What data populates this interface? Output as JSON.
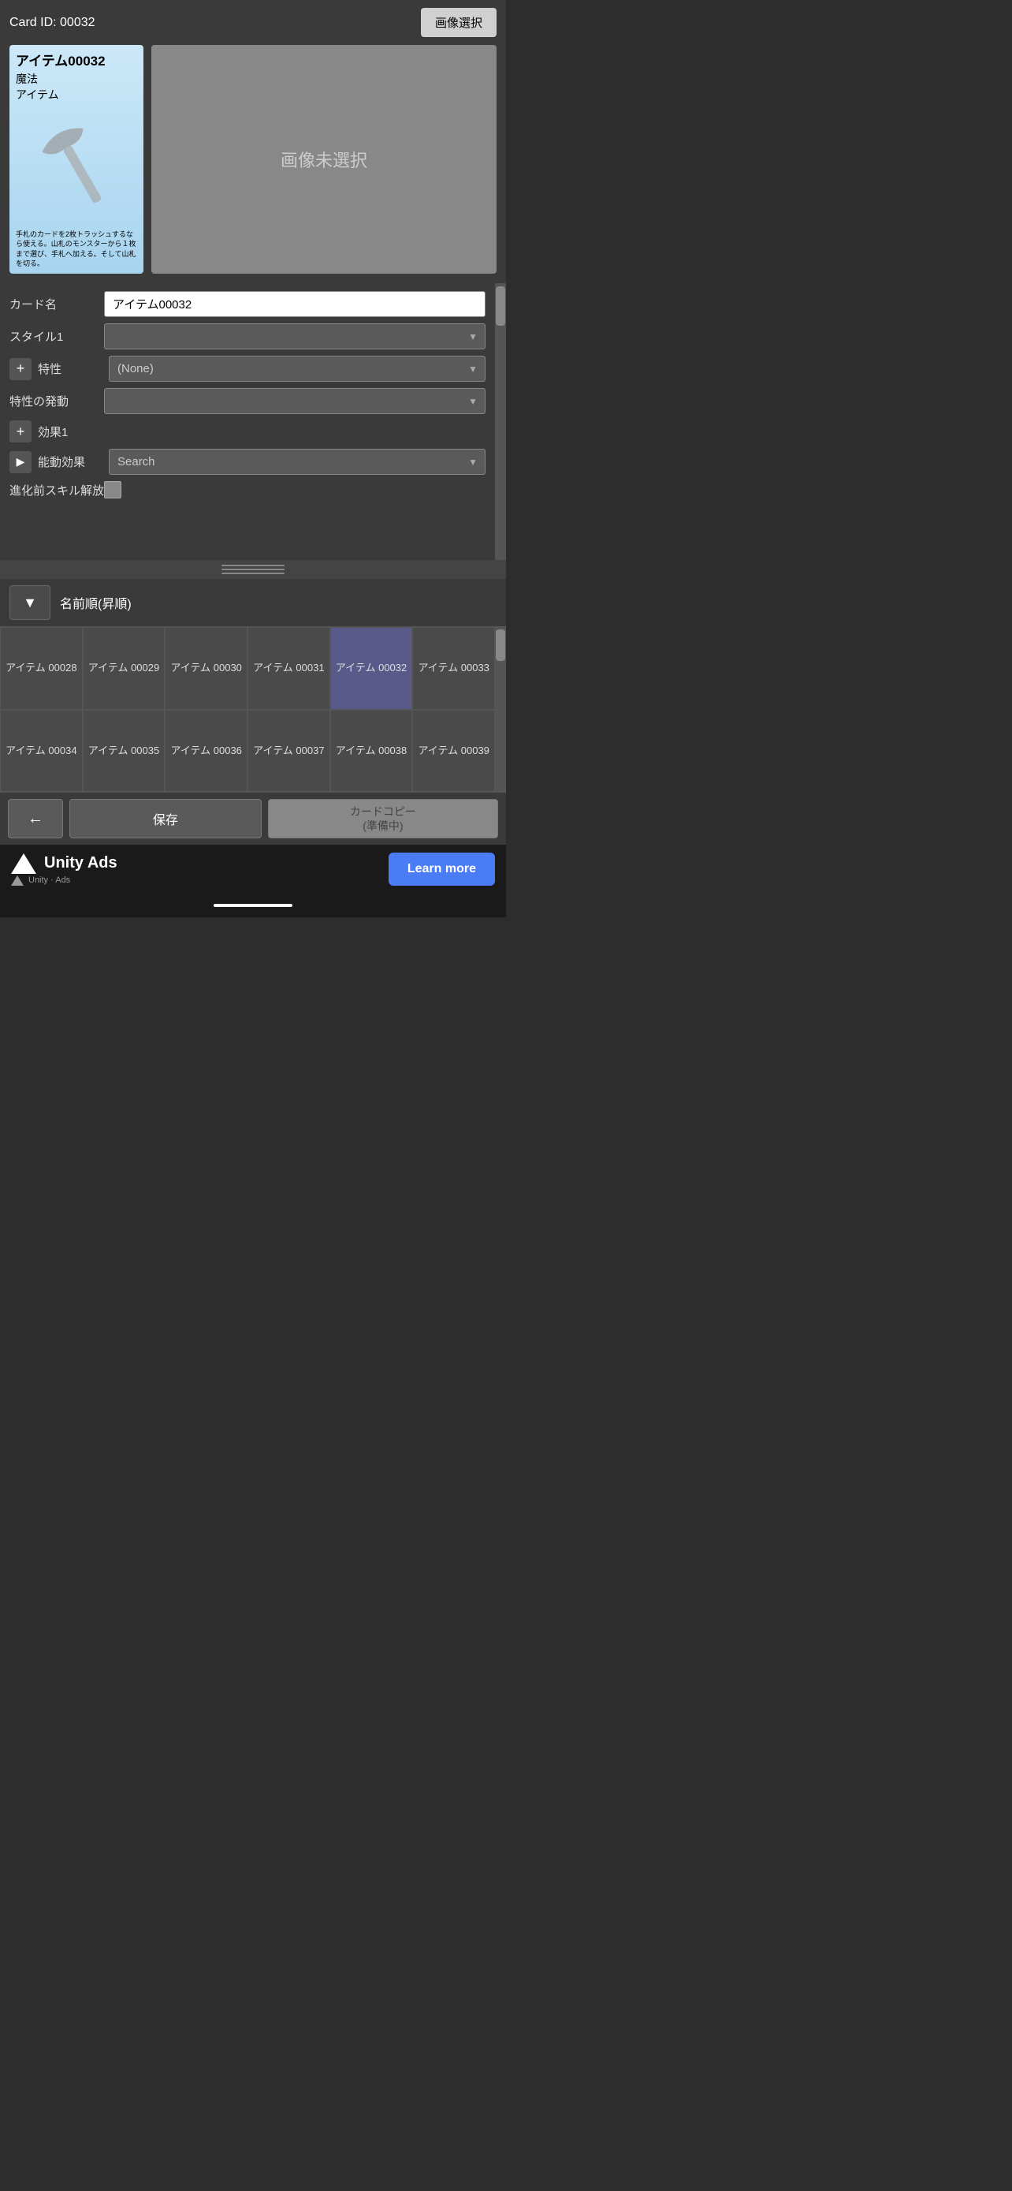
{
  "topBar": {
    "cardId": "Card ID: 00032",
    "imageSelectBtn": "画像選択"
  },
  "card": {
    "title": "アイテム00032",
    "type": "魔法",
    "subtype": "アイテム",
    "description": "手札のカードを2枚トラッシュするなら使える。山札のモンスターから１枚まで選び、手札へ加える。そして山札を切る。",
    "imagePlaceholder": "画像未選択"
  },
  "form": {
    "cardNameLabel": "カード名",
    "cardNameValue": "アイテム00032",
    "style1Label": "スタイル1",
    "style1Value": "",
    "traitLabel": "特性",
    "traitValue": "(None)",
    "traitTriggerLabel": "特性の発動",
    "traitTriggerValue": "",
    "effect1Label": "効果1",
    "activeEffectLabel": "能動効果",
    "activeEffectSearch": "Search",
    "preEvolutionLabel": "進化前スキル解放"
  },
  "sortBar": {
    "sortLabel": "名前順(昇順)"
  },
  "cardGrid": {
    "rows": [
      [
        {
          "id": "アイテム\n00028"
        },
        {
          "id": "アイテム\n00029"
        },
        {
          "id": "アイテム\n00030"
        },
        {
          "id": "アイテム\n00031"
        },
        {
          "id": "アイテム\n00032",
          "highlighted": true
        },
        {
          "id": "アイテム\n00033"
        }
      ],
      [
        {
          "id": "アイテム\n00034"
        },
        {
          "id": "アイテム\n00035"
        },
        {
          "id": "アイテム\n00036"
        },
        {
          "id": "アイテム\n00037"
        },
        {
          "id": "アイテム\n00038"
        },
        {
          "id": "アイテム\n00039"
        }
      ]
    ]
  },
  "actionBar": {
    "backBtn": "←",
    "saveBtn": "保存",
    "copyBtn": "カードコピー\n(準備中)"
  },
  "adBanner": {
    "brandName": "Unity Ads",
    "subLabel": "Unity · Ads",
    "learnMoreBtn": "Learn more"
  }
}
